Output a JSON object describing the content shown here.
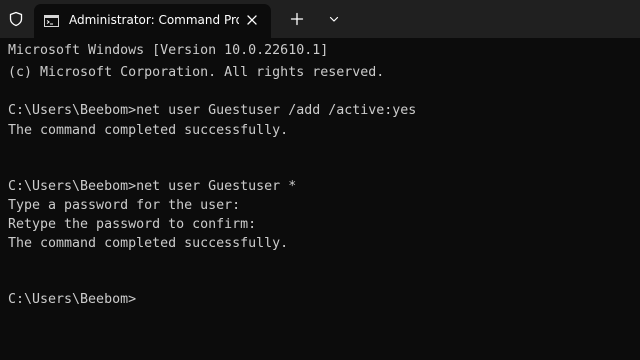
{
  "tab": {
    "title": "Administrator: Command Pro",
    "icon": "cmd-icon"
  },
  "tabbar_buttons": {
    "shield_icon": "shield-icon",
    "close_icon": "close-icon",
    "new_tab_icon": "plus-icon",
    "dropdown_icon": "chevron-down-icon"
  },
  "terminal": {
    "lines": [
      "Microsoft Windows [Version 10.0.22610.1]",
      "(c) Microsoft Corporation. All rights reserved.",
      "C:\\Users\\Beebom>net user Guestuser /add /active:yes",
      "The command completed successfully.",
      "C:\\Users\\Beebom>net user Guestuser *",
      "Type a password for the user:",
      "Retype the password to confirm:",
      "The command completed successfully.",
      "C:\\Users\\Beebom>"
    ]
  },
  "colors": {
    "background": "#0c0c0c",
    "tabbar": "#202020",
    "text": "#cccccc"
  }
}
